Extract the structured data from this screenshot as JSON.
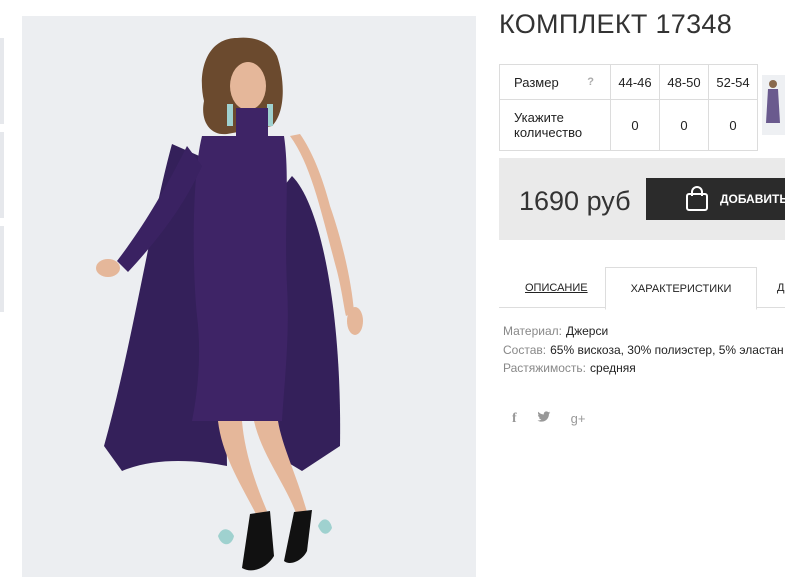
{
  "product": {
    "title": "КОМПЛЕКТ 17348",
    "price": "1690 руб",
    "buy_label": "ДОБАВИТЬ В"
  },
  "size_table": {
    "size_label": "Размер",
    "help": "?",
    "sizes": [
      "44-46",
      "48-50",
      "52-54"
    ],
    "qty_label_line1": "Укажите",
    "qty_label_line2": "количество",
    "quantities": [
      "0",
      "0",
      "0"
    ]
  },
  "tabs": {
    "description": "ОПИСАНИЕ",
    "characteristics": "ХАРАКТЕРИСТИКИ",
    "third": "Д"
  },
  "specs": [
    {
      "key": "Материал:",
      "value": "Джерси"
    },
    {
      "key": "Состав:",
      "value": "65% вискоза, 30% полиэстер, 5% эластан"
    },
    {
      "key": "Растяжимость:",
      "value": "средняя"
    }
  ],
  "social": {
    "facebook": "f",
    "googleplus": "g+"
  },
  "colors": {
    "dress": "#3e2466",
    "button": "#2b2b2b",
    "price_bg": "#eaeaea"
  }
}
